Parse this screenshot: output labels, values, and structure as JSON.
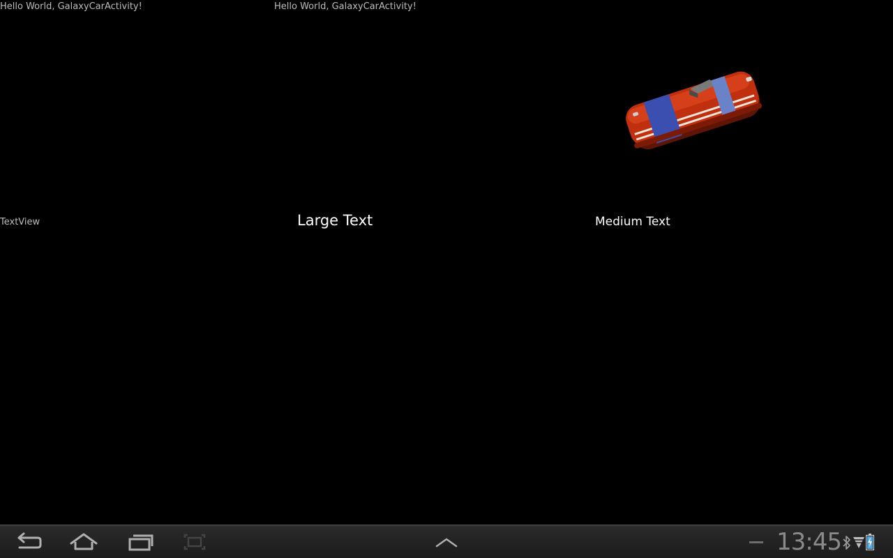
{
  "app": {
    "hello_left": "Hello World, GalaxyCarActivity!",
    "hello_right": "Hello World, GalaxyCarActivity!",
    "textview": "TextView",
    "large_text": "Large Text",
    "medium_text": "Medium Text",
    "image": "car-image"
  },
  "system_bar": {
    "clock": "13:45",
    "icons": [
      "back-icon",
      "home-icon",
      "recent-apps-icon",
      "screenshot-icon",
      "chevron-up-icon",
      "minus-icon",
      "bluetooth-icon",
      "wifi-icon",
      "battery-icon"
    ]
  },
  "colors": {
    "background": "#000000",
    "car_body": "#c0300e",
    "car_stripe": "#3a4fb0",
    "clock": "#8a8a8a"
  }
}
